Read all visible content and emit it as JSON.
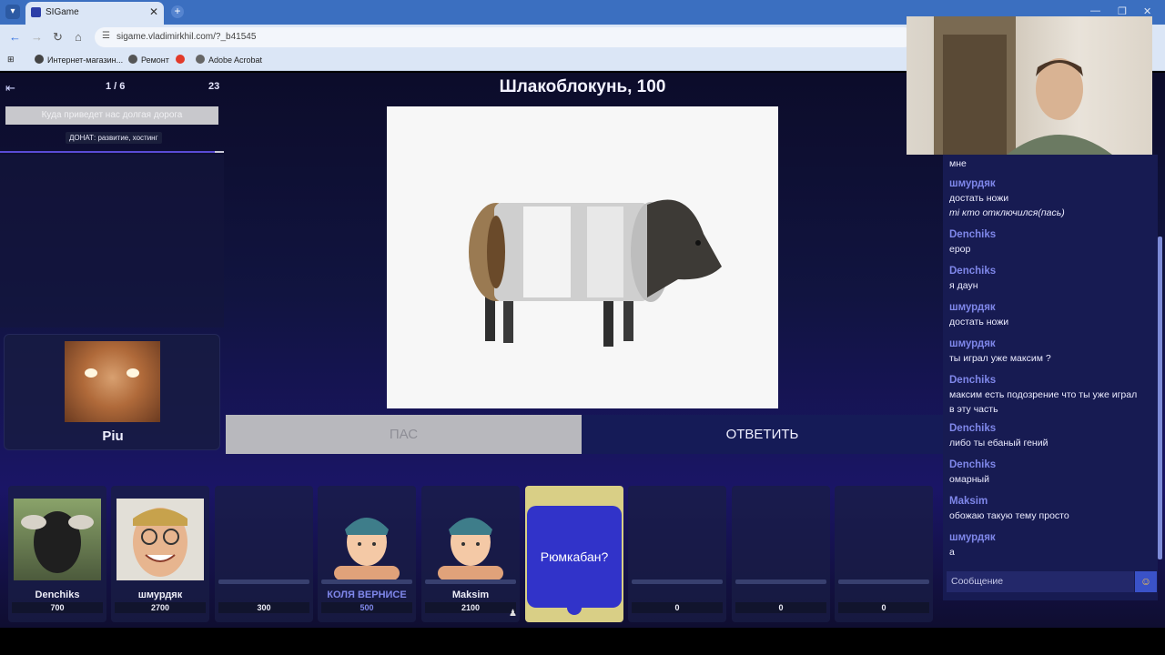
{
  "browser": {
    "tab_title": "SIGame",
    "url": "sigame.vladimirkhil.com/?_b41545",
    "bookmarks": [
      "Интернет-магазин...",
      "Ремонт",
      "Adobe Acrobat"
    ]
  },
  "game": {
    "round": "1 / 6",
    "timer": "23",
    "theme_title": "Шлакоблокунь, 100",
    "notice": "Куда приведет нас долгая дорога",
    "donate": "ДОНАТ: развитие, хостинг",
    "host_name": "Piu",
    "pass_label": "ПАС",
    "answer_label": "ОТВЕТИТЬ"
  },
  "chat": {
    "messages": [
      {
        "author": "",
        "text": "мне"
      },
      {
        "author": "шмурдяк",
        "text": "достать ножи",
        "note": "ті кто отключился(пась)"
      },
      {
        "author": "Denchiks",
        "text": "ерор"
      },
      {
        "author": "Denchiks",
        "text": "я даун"
      },
      {
        "author": "шмурдяк",
        "text": "достать ножи"
      },
      {
        "author": "шмурдяк",
        "text": "ты играл уже максим ?"
      },
      {
        "author": "Denchiks",
        "text": "максим есть подозрение что ты уже играл",
        "text2": "в эту часть"
      },
      {
        "author": "Denchiks",
        "text": "либо ты ебаный гений"
      },
      {
        "author": "Denchiks",
        "text": "омарный"
      },
      {
        "author": "Maksim",
        "text": "обожаю такую тему просто"
      },
      {
        "author": "шмурдяк",
        "text": "а"
      }
    ],
    "input_placeholder": "Сообщение"
  },
  "players": [
    {
      "name": "Denchiks",
      "score": "700"
    },
    {
      "name": "шмурдяк",
      "score": "2700"
    },
    {
      "name": "",
      "score": "300"
    },
    {
      "name": "КОЛЯ ВЕРНИСЕ",
      "score": "500"
    },
    {
      "name": "Maksim",
      "score": "2100"
    },
    {
      "name": "",
      "score": "",
      "bubble": "Рюмкабан?"
    },
    {
      "name": "",
      "score": "0"
    },
    {
      "name": "",
      "score": "0"
    },
    {
      "name": "",
      "score": "0"
    }
  ],
  "colors": {
    "accent": "#3133c9",
    "chat_author": "#7f87ea",
    "active_player": "#d9cf86"
  }
}
